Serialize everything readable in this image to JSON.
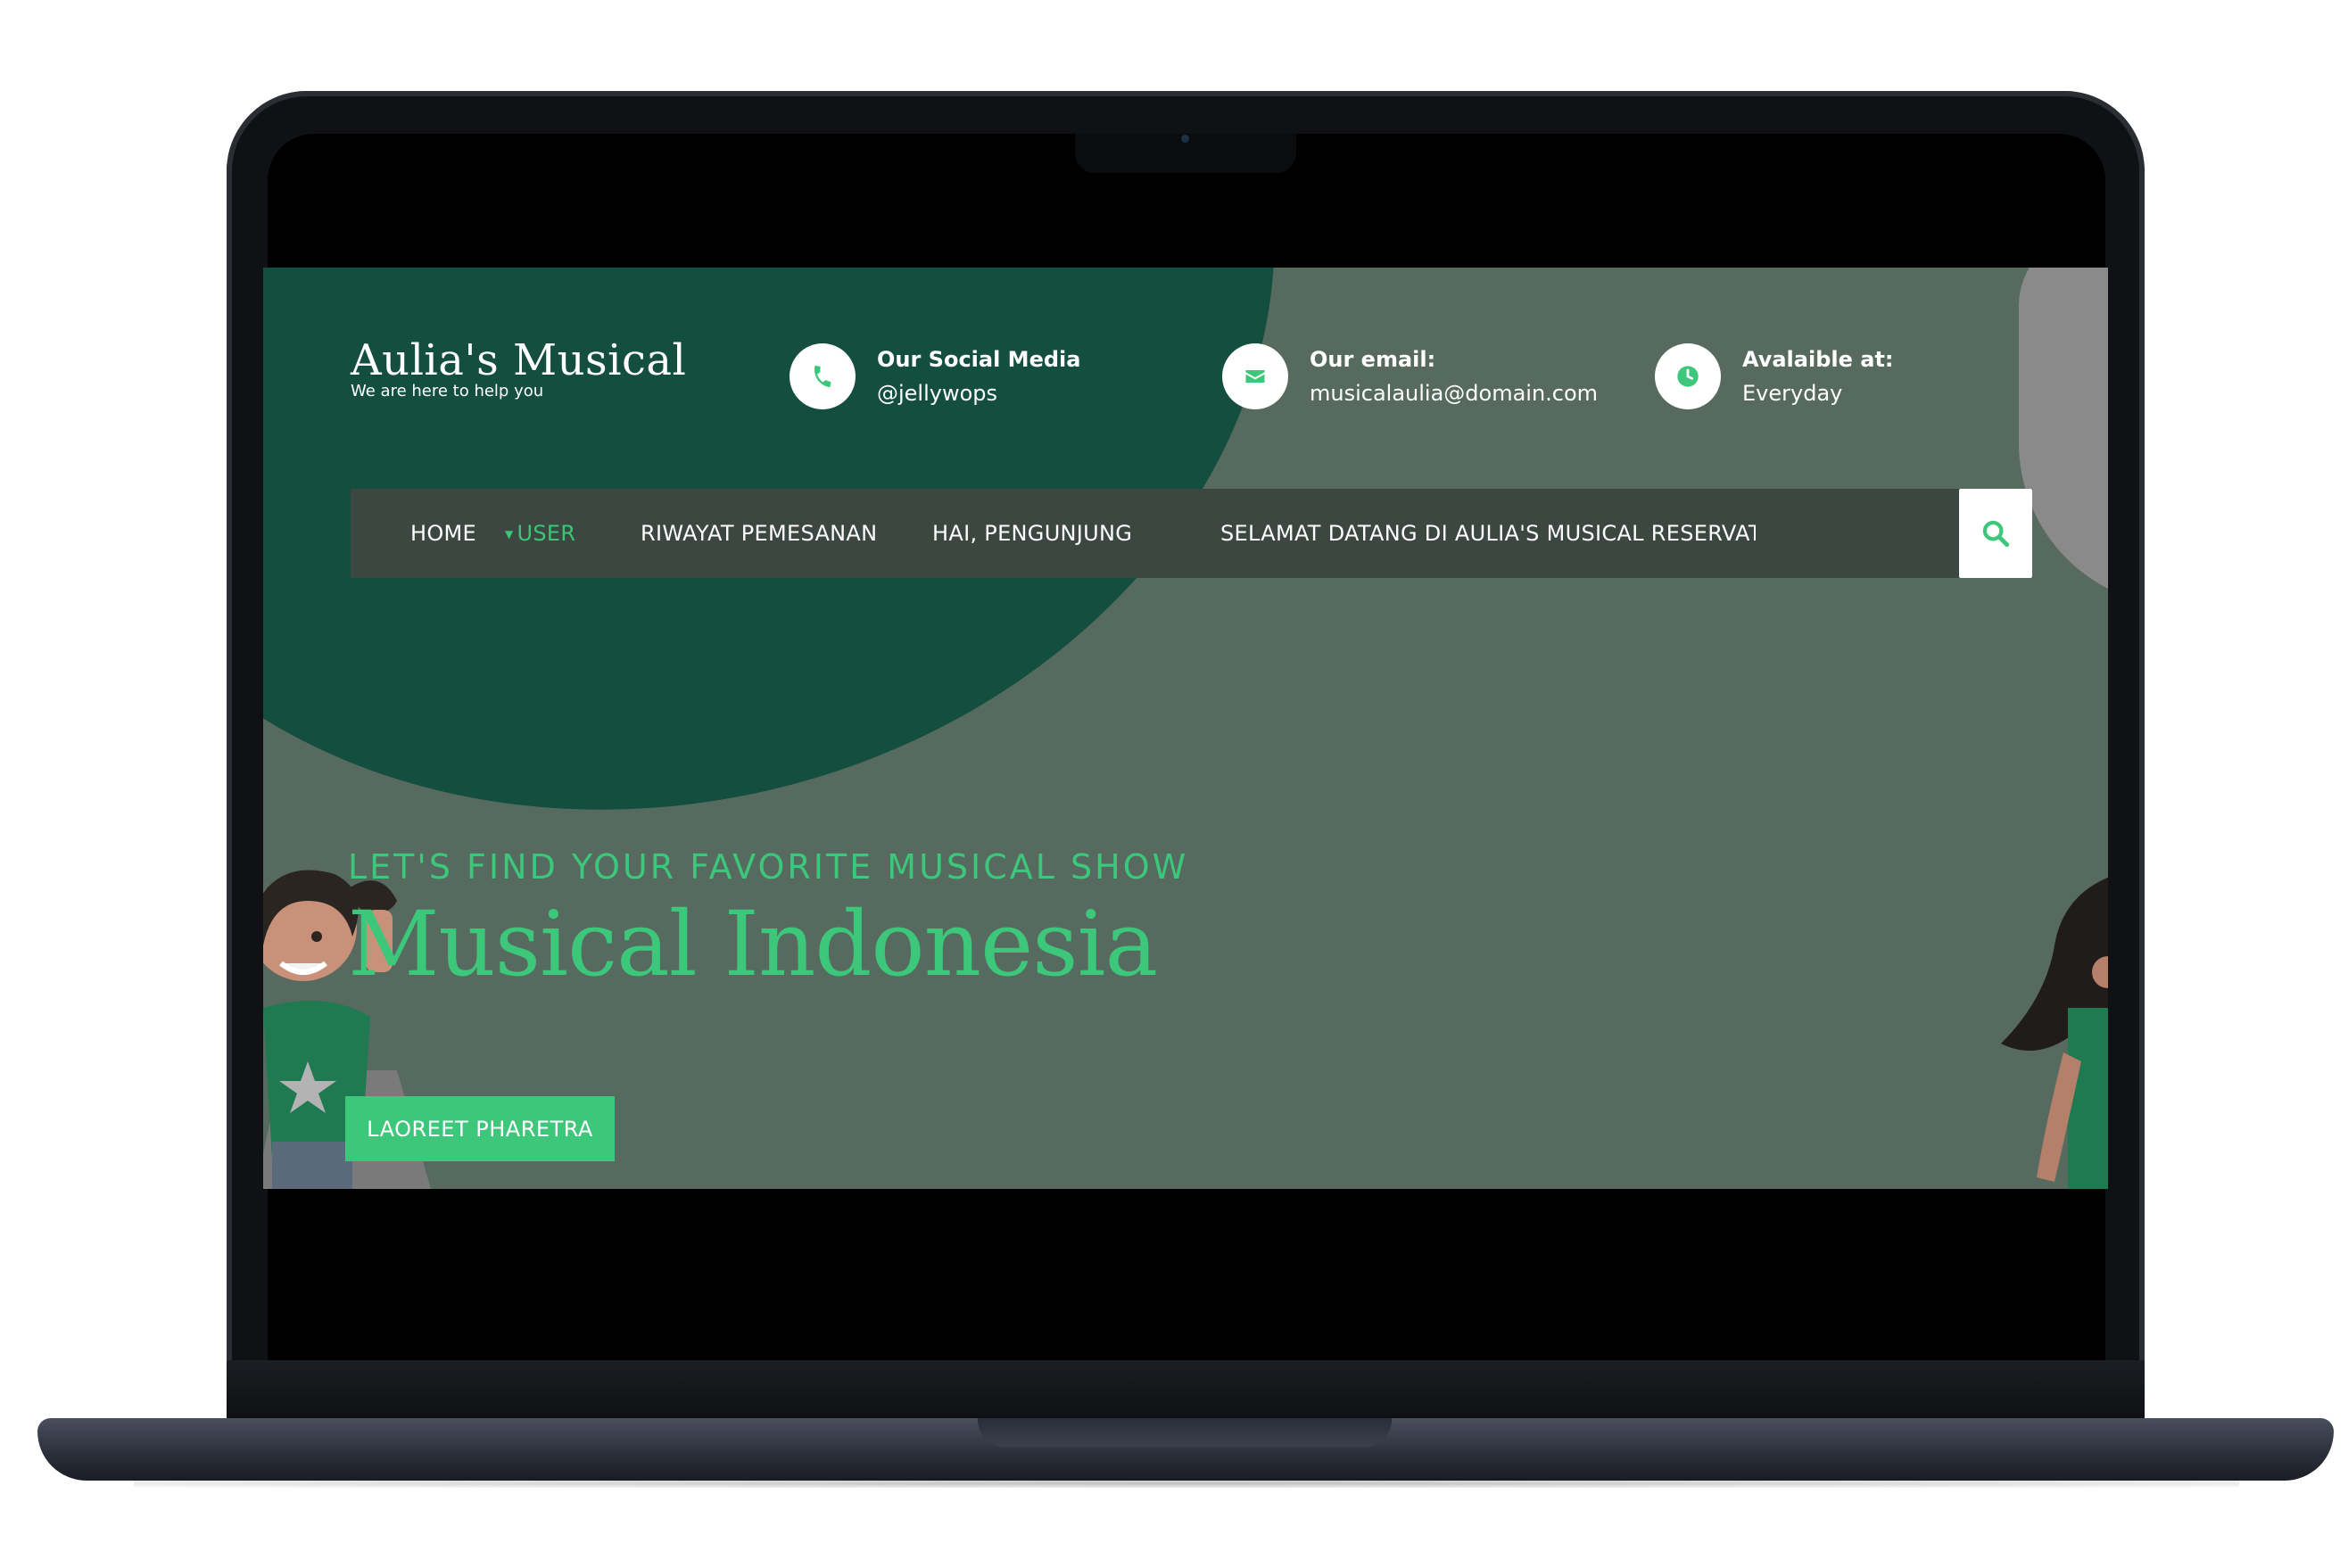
{
  "brand": {
    "title": "Aulia's Musical",
    "tagline": "We are here to help you"
  },
  "contacts": [
    {
      "icon": "phone-icon",
      "label": "Our Social Media",
      "value": "@jellywops"
    },
    {
      "icon": "envelope-icon",
      "label": "Our email:",
      "value": "musicalaulia@domain.com"
    },
    {
      "icon": "clock-icon",
      "label": "Avalaible at:",
      "value": "Everyday"
    }
  ],
  "nav": {
    "home": "HOME",
    "user": "USER",
    "history": "RIWAYAT PEMESANAN",
    "greeting": "HAI, PENGUNJUNG",
    "marquee": "SELAMAT DATANG DI AULIA'S MUSICAL RESERVAT"
  },
  "hero": {
    "subtitle": "LET'S FIND YOUR FAVORITE MUSICAL SHOW",
    "title": "Musical Indonesia",
    "cta": "LAOREET PHARETRA"
  },
  "colors": {
    "accent": "#3cc77a",
    "background": "#566a60",
    "dark_green": "#134e3e",
    "navbar": "#3c4741"
  }
}
